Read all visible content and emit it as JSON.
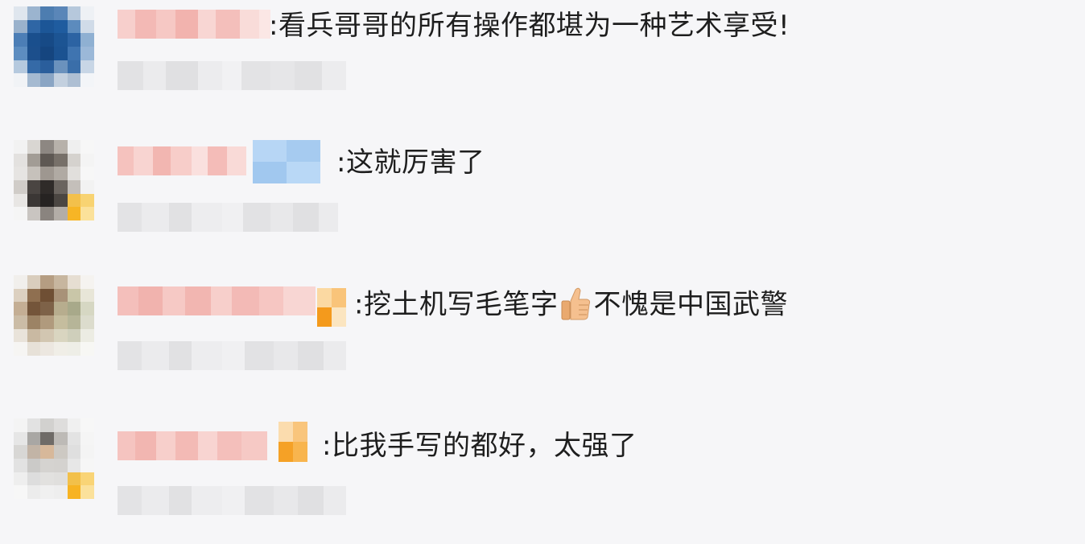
{
  "comments": [
    {
      "parts": [
        ":看兵哥哥的所有操作都堪为一种艺术享受!"
      ]
    },
    {
      "parts": [
        ":这就厉害了"
      ]
    },
    {
      "parts": [
        ":挖土机写毛笔字",
        "不愧是中国武警"
      ],
      "emoji": "thumbs-up-icon"
    },
    {
      "parts": [
        ":比我手写的都好，太强了"
      ]
    }
  ],
  "colors": {
    "background": "#f6f6f8",
    "text": "#1e1e1e",
    "blurred_name": "#f2b7b3",
    "blurred_meta": "#e4e4e6",
    "badge_orange": "#f7a21b",
    "vip_blue": "#a9cdf2"
  }
}
